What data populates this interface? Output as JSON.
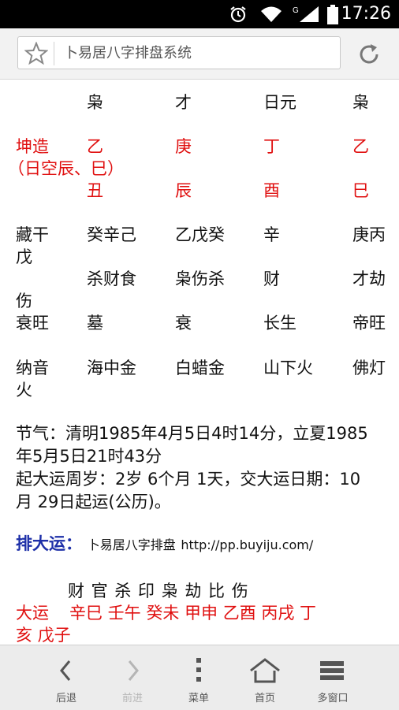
{
  "status": {
    "time": "17:26",
    "network": "G"
  },
  "browser": {
    "title": "卜易居八字排盘系统"
  },
  "chart": {
    "header": [
      "枭",
      "才",
      "日元",
      "枭"
    ],
    "gan": {
      "label": "坤造",
      "values": [
        "乙",
        "庚",
        "丁",
        "乙"
      ]
    },
    "kong_note": "（日空辰、巳）",
    "zhi": [
      "丑",
      "辰",
      "酉",
      "巳"
    ],
    "canggan": {
      "label": "藏干",
      "values": [
        "癸辛己",
        "乙戊癸",
        "辛",
        "庚丙"
      ],
      "wrap": "戊"
    },
    "shishen": {
      "values": [
        "杀财食",
        "枭伤杀",
        "财",
        "才劫"
      ],
      "wrap": "伤"
    },
    "changsheng": {
      "label": "衰旺",
      "values": [
        "墓",
        "衰",
        "长生",
        "帝旺"
      ]
    },
    "nayin": {
      "label": "纳音",
      "values": [
        "海中金",
        "白蜡金",
        "山下火",
        "佛灯"
      ],
      "wrap": "火"
    }
  },
  "jieqi": {
    "line1": "节气：清明1985年4月5日4时14分，立夏1985",
    "line2": "年5月5日21时43分",
    "line3": "起大运周岁：2岁 6个月 1天，交大运日期：10",
    "line4": "月 29日起运(公历)。"
  },
  "dayun": {
    "label": "排大运：",
    "site": "卜易居八字排盘",
    "url": "http://pp.buyiju.com/",
    "shishen_row": "财 官 杀 印 枭 劫 比 伤",
    "row_label": "大运",
    "row_values": "辛巳 壬午 癸未 甲申 乙酉 丙戌 丁",
    "row_wrap": "亥 戊子"
  },
  "toolbar": {
    "back": "后退",
    "forward": "前进",
    "menu": "菜单",
    "home": "首页",
    "windows": "多窗口"
  },
  "colors": {
    "red": "#e01010",
    "blue": "#1d2fa8"
  }
}
